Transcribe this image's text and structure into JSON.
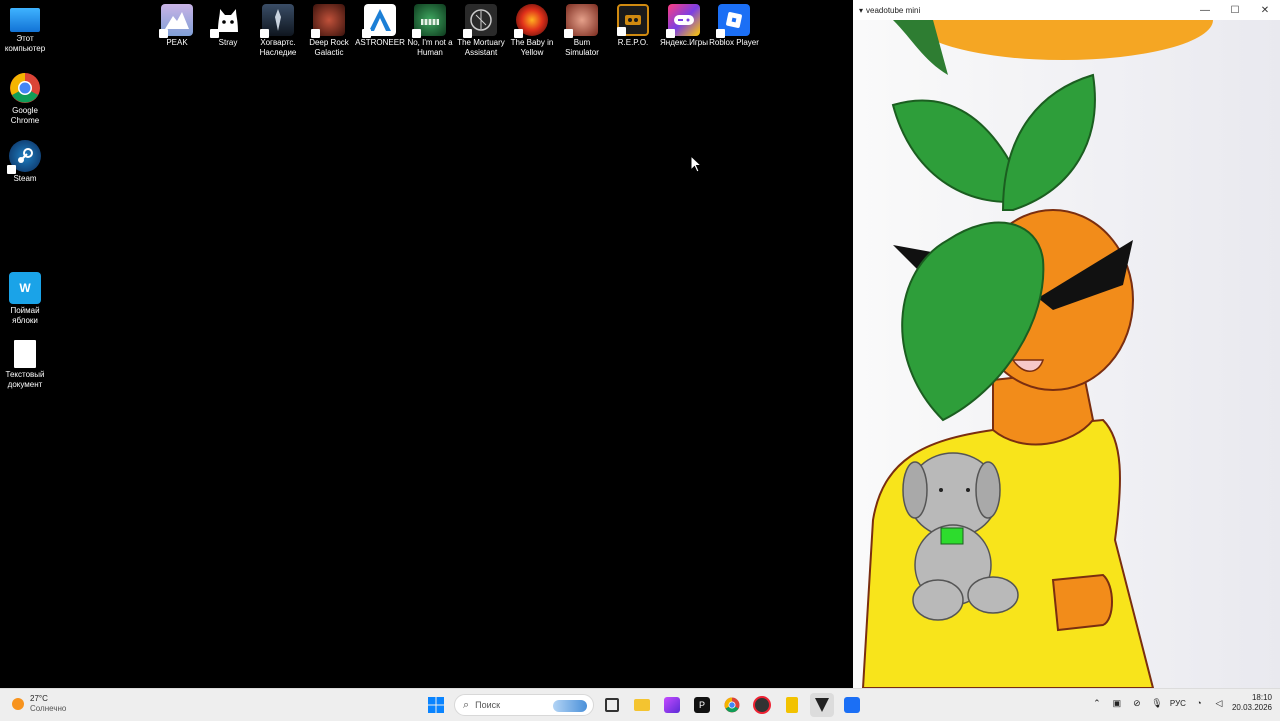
{
  "desktop": {
    "left_icons": [
      {
        "label": "Этот компьютер",
        "icon": "monitor-icon"
      },
      {
        "label": "Google Chrome",
        "icon": "chrome-icon"
      },
      {
        "label": "Steam",
        "icon": "steam-icon"
      },
      {
        "label": "Поймай яблоки",
        "icon": "app-w-icon"
      },
      {
        "label": "Текстовый документ",
        "icon": "text-file-icon"
      }
    ],
    "top_icons": [
      {
        "label": "PEAK",
        "icon": "peak-icon",
        "color": "#9aa6d6"
      },
      {
        "label": "Stray",
        "icon": "stray-cat-icon",
        "color": "#000000"
      },
      {
        "label": "Хогвартс. Наследие",
        "icon": "hogwarts-icon",
        "color": "#1e2b38"
      },
      {
        "label": "Deep Rock Galactic",
        "icon": "deep-rock-icon",
        "color": "#7a2a1e"
      },
      {
        "label": "ASTRONEER",
        "icon": "astroneer-icon",
        "color": "#1c7fd6"
      },
      {
        "label": "No, I'm not a Human",
        "icon": "not-human-icon",
        "color": "#1f6b3a"
      },
      {
        "label": "The Mortuary Assistant",
        "icon": "mortuary-icon",
        "color": "#2a2a2a"
      },
      {
        "label": "The Baby in Yellow",
        "icon": "baby-yellow-icon",
        "color": "#c0201a"
      },
      {
        "label": "Bum Simulator",
        "icon": "bum-sim-icon",
        "color": "#b5503a"
      },
      {
        "label": "R.E.P.O.",
        "icon": "repo-icon",
        "color": "#d08a10"
      },
      {
        "label": "Яндекс.Игры",
        "icon": "yandex-games-icon",
        "color": "#7b3fe4"
      },
      {
        "label": "Roblox Player",
        "icon": "roblox-icon",
        "color": "#1b6ff5"
      }
    ]
  },
  "window": {
    "title": "veadotube mini",
    "minimize": "—",
    "maximize": "☐",
    "close": "✕"
  },
  "taskbar": {
    "weather_temp": "27°C",
    "weather_desc": "Солнечно",
    "search_placeholder": "Поиск",
    "lang": "РУС",
    "time": "18:10",
    "date": "20.03.2026"
  },
  "colors": {
    "orange": "#f28c1a",
    "leaf": "#2e9e3a",
    "hoodie": "#f8e41b",
    "plush": "#b9b9b9"
  }
}
